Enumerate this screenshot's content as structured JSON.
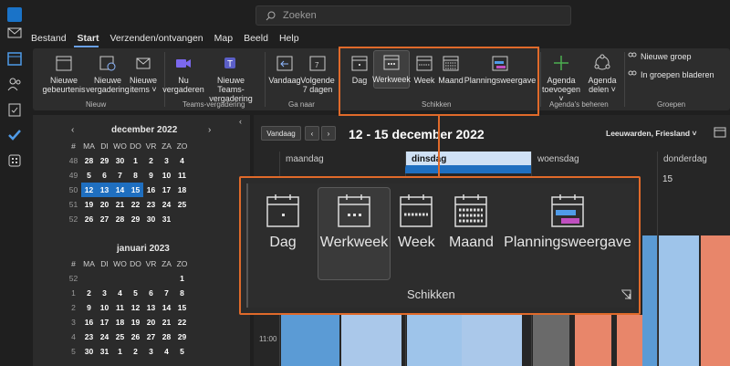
{
  "search": {
    "placeholder": "Zoeken"
  },
  "menu": [
    "Bestand",
    "Start",
    "Verzenden/ontvangen",
    "Map",
    "Beeld",
    "Help"
  ],
  "menu_active": "Start",
  "ribbon": {
    "new_events": "Nieuwe gebeurtenis",
    "new_meeting": "Nieuwe vergadering",
    "new_items": "Nieuwe items ˅",
    "group_new": "Nieuw",
    "meet_now": "Nu vergaderen",
    "new_teams": "Nieuwe Teams-vergadering",
    "group_teams": "Teams-vergadering",
    "today": "Vandaag",
    "next7": "Volgende 7 dagen",
    "group_goto": "Ga naar",
    "day": "Dag",
    "workweek": "Werkweek",
    "week": "Week",
    "month": "Maand",
    "schedule": "Planningsweergave",
    "group_arrange": "Schikken",
    "add_agenda": "Agenda toevoegen ˅",
    "share_agenda": "Agenda delen ˅",
    "group_manage": "Agenda's beheren",
    "new_group": "Nieuwe groep",
    "browse_groups": "In groepen bladeren",
    "group_groups": "Groepen"
  },
  "minical": {
    "dec_title": "december 2022",
    "jan_title": "januari 2023",
    "headers": [
      "#",
      "MA",
      "DI",
      "WO",
      "DO",
      "VR",
      "ZA",
      "ZO"
    ],
    "dec_rows": [
      [
        "48",
        "28",
        "29",
        "30",
        "1",
        "2",
        "3",
        "4"
      ],
      [
        "49",
        "5",
        "6",
        "7",
        "8",
        "9",
        "10",
        "11"
      ],
      [
        "50",
        "12",
        "13",
        "14",
        "15",
        "16",
        "17",
        "18"
      ],
      [
        "51",
        "19",
        "20",
        "21",
        "22",
        "23",
        "24",
        "25"
      ],
      [
        "52",
        "26",
        "27",
        "28",
        "29",
        "30",
        "31",
        ""
      ]
    ],
    "jan_rows": [
      [
        "52",
        "",
        "",
        "",
        "",
        "",
        "",
        "1"
      ],
      [
        "1",
        "2",
        "3",
        "4",
        "5",
        "6",
        "7",
        "8"
      ],
      [
        "2",
        "9",
        "10",
        "11",
        "12",
        "13",
        "14",
        "15"
      ],
      [
        "3",
        "16",
        "17",
        "18",
        "19",
        "20",
        "21",
        "22"
      ],
      [
        "4",
        "23",
        "24",
        "25",
        "26",
        "27",
        "28",
        "29"
      ],
      [
        "5",
        "30",
        "31",
        "1",
        "2",
        "3",
        "4",
        "5"
      ]
    ]
  },
  "calendar": {
    "today_btn": "Vandaag",
    "range": "12 - 15 december 2022",
    "location": "Leeuwarden, Friesland ˅",
    "days": [
      "maandag",
      "dinsdag",
      "woensdag",
      "donderdag"
    ],
    "day15": "15",
    "time_label": "11:00"
  },
  "zoom": {
    "day": "Dag",
    "workweek": "Werkweek",
    "week": "Week",
    "month": "Maand",
    "schedule": "Planningsweergave",
    "group": "Schikken"
  },
  "colors": {
    "accent": "#e06a2a",
    "selection": "#1f6fc0",
    "event_blue": "#5b9bd5",
    "event_orange": "#e8866a"
  }
}
